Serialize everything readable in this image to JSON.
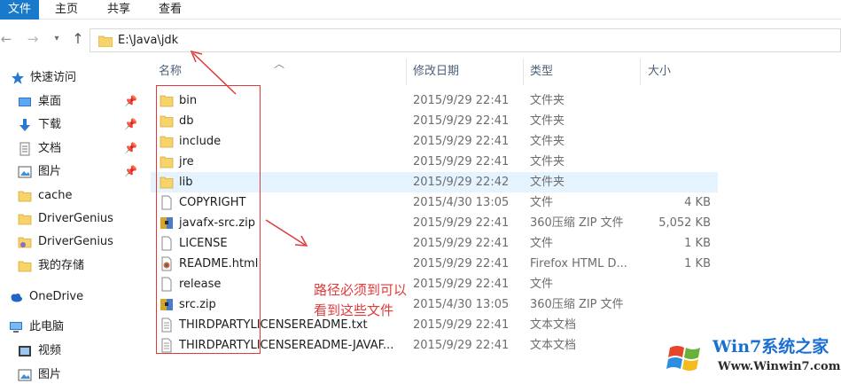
{
  "ribbon": {
    "tabs": [
      "文件",
      "主页",
      "共享",
      "查看"
    ]
  },
  "address": {
    "path": "E:\\Java\\jdk"
  },
  "sidebar": {
    "quick_access": "快速访问",
    "items": [
      {
        "label": "桌面",
        "icon": "desktop-icon",
        "pinned": true
      },
      {
        "label": "下载",
        "icon": "download-icon",
        "pinned": true
      },
      {
        "label": "文档",
        "icon": "documents-icon",
        "pinned": true
      },
      {
        "label": "图片",
        "icon": "pictures-icon",
        "pinned": true
      },
      {
        "label": "cache",
        "icon": "folder-icon",
        "pinned": false
      },
      {
        "label": "DriverGenius",
        "icon": "folder-icon",
        "pinned": false
      },
      {
        "label": "DriverGenius",
        "icon": "app-folder-icon",
        "pinned": false
      },
      {
        "label": "我的存储",
        "icon": "folder-icon",
        "pinned": false
      }
    ],
    "onedrive": "OneDrive",
    "this_pc": "此电脑",
    "pc_items": [
      {
        "label": "视频",
        "icon": "video-icon"
      },
      {
        "label": "图片",
        "icon": "pictures-icon"
      }
    ]
  },
  "columns": {
    "name": "名称",
    "date": "修改日期",
    "type": "类型",
    "size": "大小"
  },
  "files": [
    {
      "name": "bin",
      "date": "2015/9/29 22:41",
      "type": "文件夹",
      "size": "",
      "icon": "folder-icon"
    },
    {
      "name": "db",
      "date": "2015/9/29 22:41",
      "type": "文件夹",
      "size": "",
      "icon": "folder-icon"
    },
    {
      "name": "include",
      "date": "2015/9/29 22:41",
      "type": "文件夹",
      "size": "",
      "icon": "folder-icon"
    },
    {
      "name": "jre",
      "date": "2015/9/29 22:41",
      "type": "文件夹",
      "size": "",
      "icon": "folder-icon"
    },
    {
      "name": "lib",
      "date": "2015/9/29 22:42",
      "type": "文件夹",
      "size": "",
      "icon": "folder-icon",
      "selected": true
    },
    {
      "name": "COPYRIGHT",
      "date": "2015/4/30 13:05",
      "type": "文件",
      "size": "4 KB",
      "icon": "file-icon"
    },
    {
      "name": "javafx-src.zip",
      "date": "2015/9/29 22:41",
      "type": "360压缩 ZIP 文件",
      "size": "5,052 KB",
      "icon": "zip-icon"
    },
    {
      "name": "LICENSE",
      "date": "2015/9/29 22:41",
      "type": "文件",
      "size": "1 KB",
      "icon": "file-icon"
    },
    {
      "name": "README.html",
      "date": "2015/9/29 22:41",
      "type": "Firefox HTML D...",
      "size": "1 KB",
      "icon": "html-icon"
    },
    {
      "name": "release",
      "date": "2015/9/29 22:41",
      "type": "文件",
      "size": "",
      "icon": "file-icon"
    },
    {
      "name": "src.zip",
      "date": "2015/4/30 13:05",
      "type": "360压缩 ZIP 文件",
      "size": "",
      "icon": "zip-icon"
    },
    {
      "name": "THIRDPARTYLICENSEREADME.txt",
      "date": "2015/9/29 22:41",
      "type": "文本文档",
      "size": "",
      "icon": "text-icon"
    },
    {
      "name": "THIRDPARTYLICENSEREADME-JAVAF...",
      "date": "2015/9/29 22:41",
      "type": "文本文档",
      "size": "",
      "icon": "text-icon"
    }
  ],
  "annotation": {
    "note_line1": "路径必须到可以",
    "note_line2": "看到这些文件",
    "color": "#e03a3a"
  },
  "watermark": {
    "title": "Win7系统之家",
    "url": "Www.Winwin7.com"
  },
  "colors": {
    "accent": "#1979ca",
    "selected_row": "#e5f3ff",
    "folder": "#f7d36b"
  }
}
